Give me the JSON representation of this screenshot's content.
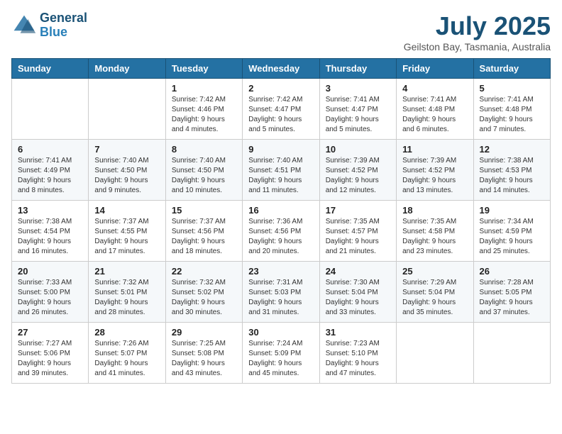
{
  "header": {
    "logo_line1": "General",
    "logo_line2": "Blue",
    "month_year": "July 2025",
    "location": "Geilston Bay, Tasmania, Australia"
  },
  "weekdays": [
    "Sunday",
    "Monday",
    "Tuesday",
    "Wednesday",
    "Thursday",
    "Friday",
    "Saturday"
  ],
  "weeks": [
    [
      {
        "day": "",
        "sunrise": "",
        "sunset": "",
        "daylight": ""
      },
      {
        "day": "",
        "sunrise": "",
        "sunset": "",
        "daylight": ""
      },
      {
        "day": "1",
        "sunrise": "Sunrise: 7:42 AM",
        "sunset": "Sunset: 4:46 PM",
        "daylight": "Daylight: 9 hours and 4 minutes."
      },
      {
        "day": "2",
        "sunrise": "Sunrise: 7:42 AM",
        "sunset": "Sunset: 4:47 PM",
        "daylight": "Daylight: 9 hours and 5 minutes."
      },
      {
        "day": "3",
        "sunrise": "Sunrise: 7:41 AM",
        "sunset": "Sunset: 4:47 PM",
        "daylight": "Daylight: 9 hours and 5 minutes."
      },
      {
        "day": "4",
        "sunrise": "Sunrise: 7:41 AM",
        "sunset": "Sunset: 4:48 PM",
        "daylight": "Daylight: 9 hours and 6 minutes."
      },
      {
        "day": "5",
        "sunrise": "Sunrise: 7:41 AM",
        "sunset": "Sunset: 4:48 PM",
        "daylight": "Daylight: 9 hours and 7 minutes."
      }
    ],
    [
      {
        "day": "6",
        "sunrise": "Sunrise: 7:41 AM",
        "sunset": "Sunset: 4:49 PM",
        "daylight": "Daylight: 9 hours and 8 minutes."
      },
      {
        "day": "7",
        "sunrise": "Sunrise: 7:40 AM",
        "sunset": "Sunset: 4:50 PM",
        "daylight": "Daylight: 9 hours and 9 minutes."
      },
      {
        "day": "8",
        "sunrise": "Sunrise: 7:40 AM",
        "sunset": "Sunset: 4:50 PM",
        "daylight": "Daylight: 9 hours and 10 minutes."
      },
      {
        "day": "9",
        "sunrise": "Sunrise: 7:40 AM",
        "sunset": "Sunset: 4:51 PM",
        "daylight": "Daylight: 9 hours and 11 minutes."
      },
      {
        "day": "10",
        "sunrise": "Sunrise: 7:39 AM",
        "sunset": "Sunset: 4:52 PM",
        "daylight": "Daylight: 9 hours and 12 minutes."
      },
      {
        "day": "11",
        "sunrise": "Sunrise: 7:39 AM",
        "sunset": "Sunset: 4:52 PM",
        "daylight": "Daylight: 9 hours and 13 minutes."
      },
      {
        "day": "12",
        "sunrise": "Sunrise: 7:38 AM",
        "sunset": "Sunset: 4:53 PM",
        "daylight": "Daylight: 9 hours and 14 minutes."
      }
    ],
    [
      {
        "day": "13",
        "sunrise": "Sunrise: 7:38 AM",
        "sunset": "Sunset: 4:54 PM",
        "daylight": "Daylight: 9 hours and 16 minutes."
      },
      {
        "day": "14",
        "sunrise": "Sunrise: 7:37 AM",
        "sunset": "Sunset: 4:55 PM",
        "daylight": "Daylight: 9 hours and 17 minutes."
      },
      {
        "day": "15",
        "sunrise": "Sunrise: 7:37 AM",
        "sunset": "Sunset: 4:56 PM",
        "daylight": "Daylight: 9 hours and 18 minutes."
      },
      {
        "day": "16",
        "sunrise": "Sunrise: 7:36 AM",
        "sunset": "Sunset: 4:56 PM",
        "daylight": "Daylight: 9 hours and 20 minutes."
      },
      {
        "day": "17",
        "sunrise": "Sunrise: 7:35 AM",
        "sunset": "Sunset: 4:57 PM",
        "daylight": "Daylight: 9 hours and 21 minutes."
      },
      {
        "day": "18",
        "sunrise": "Sunrise: 7:35 AM",
        "sunset": "Sunset: 4:58 PM",
        "daylight": "Daylight: 9 hours and 23 minutes."
      },
      {
        "day": "19",
        "sunrise": "Sunrise: 7:34 AM",
        "sunset": "Sunset: 4:59 PM",
        "daylight": "Daylight: 9 hours and 25 minutes."
      }
    ],
    [
      {
        "day": "20",
        "sunrise": "Sunrise: 7:33 AM",
        "sunset": "Sunset: 5:00 PM",
        "daylight": "Daylight: 9 hours and 26 minutes."
      },
      {
        "day": "21",
        "sunrise": "Sunrise: 7:32 AM",
        "sunset": "Sunset: 5:01 PM",
        "daylight": "Daylight: 9 hours and 28 minutes."
      },
      {
        "day": "22",
        "sunrise": "Sunrise: 7:32 AM",
        "sunset": "Sunset: 5:02 PM",
        "daylight": "Daylight: 9 hours and 30 minutes."
      },
      {
        "day": "23",
        "sunrise": "Sunrise: 7:31 AM",
        "sunset": "Sunset: 5:03 PM",
        "daylight": "Daylight: 9 hours and 31 minutes."
      },
      {
        "day": "24",
        "sunrise": "Sunrise: 7:30 AM",
        "sunset": "Sunset: 5:04 PM",
        "daylight": "Daylight: 9 hours and 33 minutes."
      },
      {
        "day": "25",
        "sunrise": "Sunrise: 7:29 AM",
        "sunset": "Sunset: 5:04 PM",
        "daylight": "Daylight: 9 hours and 35 minutes."
      },
      {
        "day": "26",
        "sunrise": "Sunrise: 7:28 AM",
        "sunset": "Sunset: 5:05 PM",
        "daylight": "Daylight: 9 hours and 37 minutes."
      }
    ],
    [
      {
        "day": "27",
        "sunrise": "Sunrise: 7:27 AM",
        "sunset": "Sunset: 5:06 PM",
        "daylight": "Daylight: 9 hours and 39 minutes."
      },
      {
        "day": "28",
        "sunrise": "Sunrise: 7:26 AM",
        "sunset": "Sunset: 5:07 PM",
        "daylight": "Daylight: 9 hours and 41 minutes."
      },
      {
        "day": "29",
        "sunrise": "Sunrise: 7:25 AM",
        "sunset": "Sunset: 5:08 PM",
        "daylight": "Daylight: 9 hours and 43 minutes."
      },
      {
        "day": "30",
        "sunrise": "Sunrise: 7:24 AM",
        "sunset": "Sunset: 5:09 PM",
        "daylight": "Daylight: 9 hours and 45 minutes."
      },
      {
        "day": "31",
        "sunrise": "Sunrise: 7:23 AM",
        "sunset": "Sunset: 5:10 PM",
        "daylight": "Daylight: 9 hours and 47 minutes."
      },
      {
        "day": "",
        "sunrise": "",
        "sunset": "",
        "daylight": ""
      },
      {
        "day": "",
        "sunrise": "",
        "sunset": "",
        "daylight": ""
      }
    ]
  ]
}
